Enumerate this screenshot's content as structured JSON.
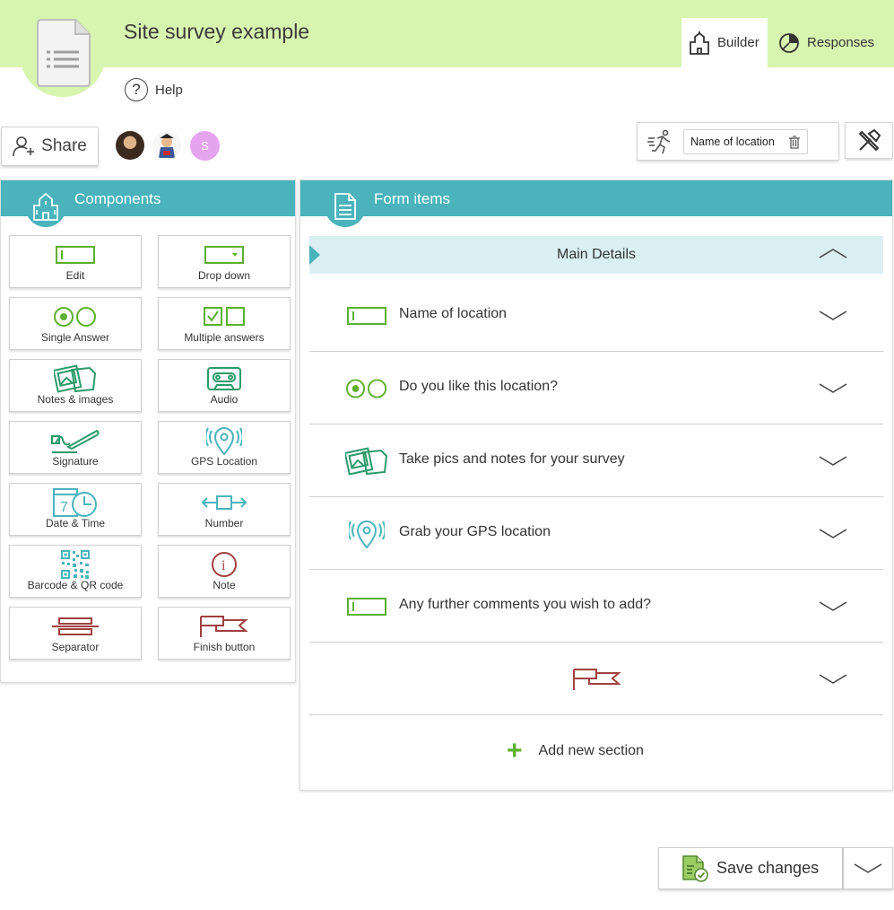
{
  "header": {
    "title": "Site survey example",
    "help_label": "Help",
    "tabs": [
      {
        "label": "Builder",
        "icon": "building-icon",
        "active": true
      },
      {
        "label": "Responses",
        "icon": "pie-chart-icon",
        "active": false
      }
    ]
  },
  "toolbar": {
    "share_label": "Share",
    "avatars": [
      {
        "initial": ""
      },
      {
        "initial": ""
      },
      {
        "initial": "S"
      }
    ],
    "filter_chip_label": "Name of location"
  },
  "components": {
    "title": "Components",
    "items": [
      {
        "label": "Edit",
        "icon": "edit-field-icon"
      },
      {
        "label": "Drop down",
        "icon": "dropdown-icon"
      },
      {
        "label": "Single Answer",
        "icon": "single-answer-icon"
      },
      {
        "label": "Multiple answers",
        "icon": "multiple-answers-icon"
      },
      {
        "label": "Notes & images",
        "icon": "notes-images-icon"
      },
      {
        "label": "Audio",
        "icon": "audio-icon"
      },
      {
        "label": "Signature",
        "icon": "signature-icon"
      },
      {
        "label": "GPS Location",
        "icon": "gps-icon"
      },
      {
        "label": "Date & Time",
        "icon": "date-time-icon"
      },
      {
        "label": "Number",
        "icon": "number-icon"
      },
      {
        "label": "Barcode & QR code",
        "icon": "qr-code-icon"
      },
      {
        "label": "Note",
        "icon": "info-icon"
      },
      {
        "label": "Separator",
        "icon": "separator-icon"
      },
      {
        "label": "Finish button",
        "icon": "finish-flag-icon"
      }
    ]
  },
  "form": {
    "title": "Form items",
    "section_title": "Main Details",
    "rows": [
      {
        "label": "Name of location",
        "icon": "edit-field-icon"
      },
      {
        "label": "Do you like this location?",
        "icon": "single-answer-icon"
      },
      {
        "label": "Take pics and notes for your survey",
        "icon": "notes-images-icon"
      },
      {
        "label": "Grab your GPS location",
        "icon": "gps-icon"
      },
      {
        "label": "Any further comments you wish to add?",
        "icon": "edit-field-icon"
      },
      {
        "label": "",
        "icon": "finish-flag-icon"
      }
    ],
    "add_section_label": "Add new section"
  },
  "footer": {
    "save_label": "Save changes"
  },
  "colors": {
    "header_bg": "#d8f5b0",
    "panel_head": "#4ab3bc",
    "accent_green": "#5cb02e",
    "teal_icon": "#4ab3bc",
    "dark_red_icon": "#a04040"
  }
}
